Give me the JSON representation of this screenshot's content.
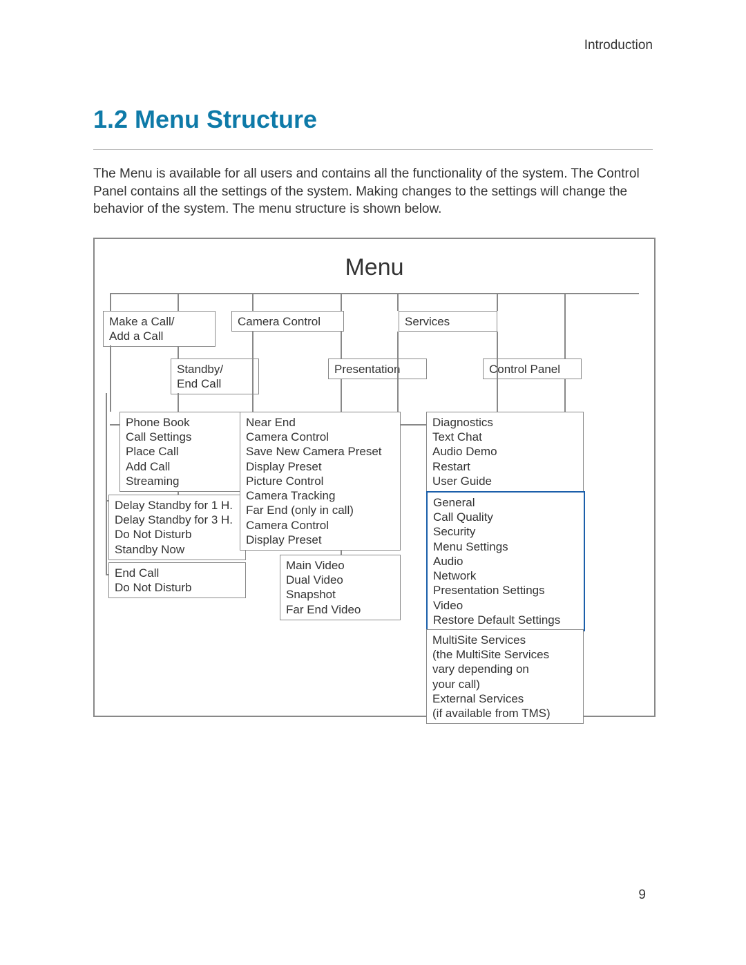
{
  "header": {
    "label": "Introduction"
  },
  "section": {
    "number": "1.2",
    "title": "Menu Structure",
    "full_title": "1.2 Menu Structure",
    "intro": "The Menu is available for all users and contains all the functionality of the system. The Control Panel contains all the settings of the system. Making changes to the settings will change the behavior of the system. The menu structure is shown below."
  },
  "diagram": {
    "root": "Menu",
    "row1": {
      "make_call": "Make a Call/\nAdd a Call",
      "camera_control": "Camera Control",
      "services": "Services"
    },
    "row2": {
      "standby": "Standby/\nEnd Call",
      "presentation": "Presentation",
      "control_panel": "Control Panel"
    },
    "col1": {
      "phonebook_box": "Phone Book\nCall Settings\nPlace Call\nAdd Call\nStreaming",
      "delay_box": "Delay Standby for 1 H.\nDelay Standby for 3 H.\nDo Not Disturb\nStandby Now",
      "endcall_box": "End Call\nDo Not Disturb"
    },
    "col2": {
      "nearend_box": "Near End\n  Camera Control\n  Save New Camera Preset\n  Display Preset\n  Picture Control\n  Camera Tracking\nFar End (only in call)\n  Camera Control\n  Display Preset",
      "video_box": "Main Video\nDual Video\nSnapshot\nFar End Video"
    },
    "col3": {
      "diag_box": "Diagnostics\nText Chat\nAudio Demo\nRestart\nUser Guide",
      "settings_box": "General\nCall Quality\nSecurity\nMenu Settings\nAudio\nNetwork\nPresentation Settings\nVideo\nRestore Default Settings",
      "multisite_box": "MultiSite Services\n(the MultiSite Services\nvary depending on\nyour call)\nExternal Services\n(if available from TMS)"
    }
  },
  "page_number": "9"
}
